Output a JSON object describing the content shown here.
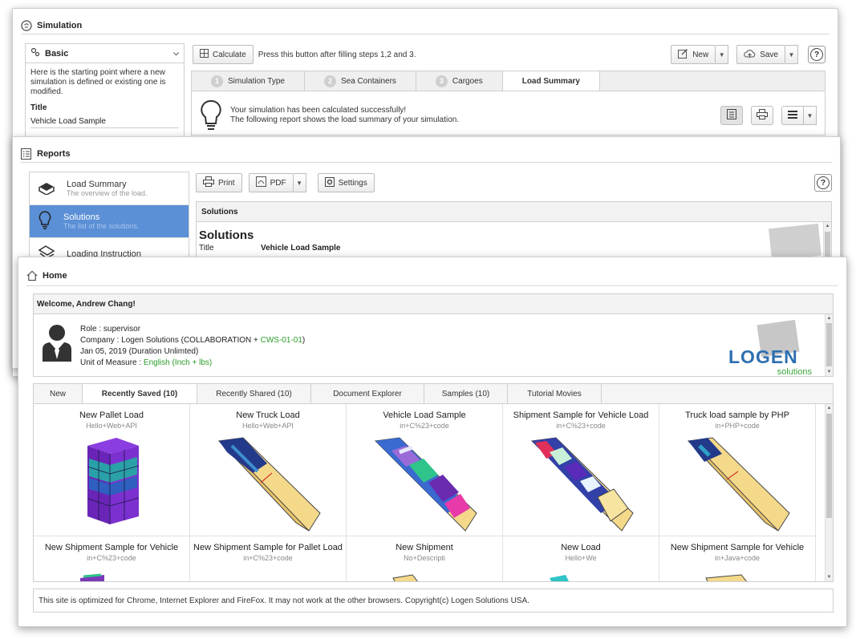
{
  "simulation": {
    "title": "Simulation",
    "side": {
      "select_label": "Basic",
      "description": "Here is the starting point where a new simulation is defined or existing one is modified.",
      "title_label": "Title",
      "title_value": "Vehicle Load Sample"
    },
    "toolbar": {
      "calculate_label": "Calculate",
      "hint": "Press this button after filling steps 1,2 and 3.",
      "new_label": "New",
      "save_label": "Save"
    },
    "tabs": [
      {
        "num": "1",
        "label": "Simulation Type"
      },
      {
        "num": "2",
        "label": "Sea Containers"
      },
      {
        "num": "3",
        "label": "Cargoes"
      },
      {
        "num": "",
        "label": "Load Summary"
      }
    ],
    "message_line1": "Your simulation has been calculated successfully!",
    "message_line2": "The following report shows the load summary of your simulation."
  },
  "reports": {
    "title": "Reports",
    "items": [
      {
        "title": "Load Summary",
        "subtitle": "The overview of the load."
      },
      {
        "title": "Solutions",
        "subtitle": "The list of the solutions."
      },
      {
        "title": "Loading Instruction",
        "subtitle": ""
      }
    ],
    "toolbar": {
      "print_label": "Print",
      "pdf_label": "PDF",
      "settings_label": "Settings"
    },
    "content": {
      "header": "Solutions",
      "heading": "Solutions",
      "row_key": "Title",
      "row_value": "Vehicle Load Sample"
    }
  },
  "home": {
    "title": "Home",
    "welcome": "Welcome, Andrew Chang!",
    "role": "Role : supervisor",
    "company_prefix": "Company : Logen Solutions (COLLABORATION + ",
    "company_code": "CWS-01-01",
    "company_suffix": ")",
    "date": "Jan 05, 2019 (Duration Unlimted)",
    "uom_prefix": "Unit of Measure : ",
    "uom_value": "English (Inch + lbs)",
    "logo_main": "LOGEN",
    "logo_sub": "solutions",
    "tabs": [
      "New",
      "Recently Saved (10)",
      "Recently Shared (10)",
      "Document Explorer",
      "Samples (10)",
      "Tutorial Movies"
    ],
    "cards": [
      {
        "title": "New Pallet Load",
        "sub": "Hello+Web+API"
      },
      {
        "title": "New Truck Load",
        "sub": "Hello+Web+API"
      },
      {
        "title": "Vehicle Load Sample",
        "sub": "in+C%23+code"
      },
      {
        "title": "Shipment Sample for Vehicle Load",
        "sub": "in+C%23+code"
      },
      {
        "title": "Truck load sample by PHP",
        "sub": "in+PHP+code"
      },
      {
        "title": "New Shipment Sample for Vehicle",
        "sub": "in+C%23+code"
      },
      {
        "title": "New Shipment Sample for Pallet Load",
        "sub": "in+C%23+code"
      },
      {
        "title": "New Shipment",
        "sub": "No+Descripti"
      },
      {
        "title": "New Load",
        "sub": "Hello+We"
      },
      {
        "title": "New Shipment Sample for Vehicle",
        "sub": "in+Java+code"
      }
    ],
    "footer": "This site is optimized for Chrome, Internet Explorer and FireFox. It may not work at the other browsers. Copyright(c) Logen Solutions USA."
  },
  "colors": {
    "accent": "#5b8fd6",
    "logo_blue": "#2e6fb0",
    "logo_green": "#3aa53a",
    "link_green": "#2a9d2a"
  }
}
